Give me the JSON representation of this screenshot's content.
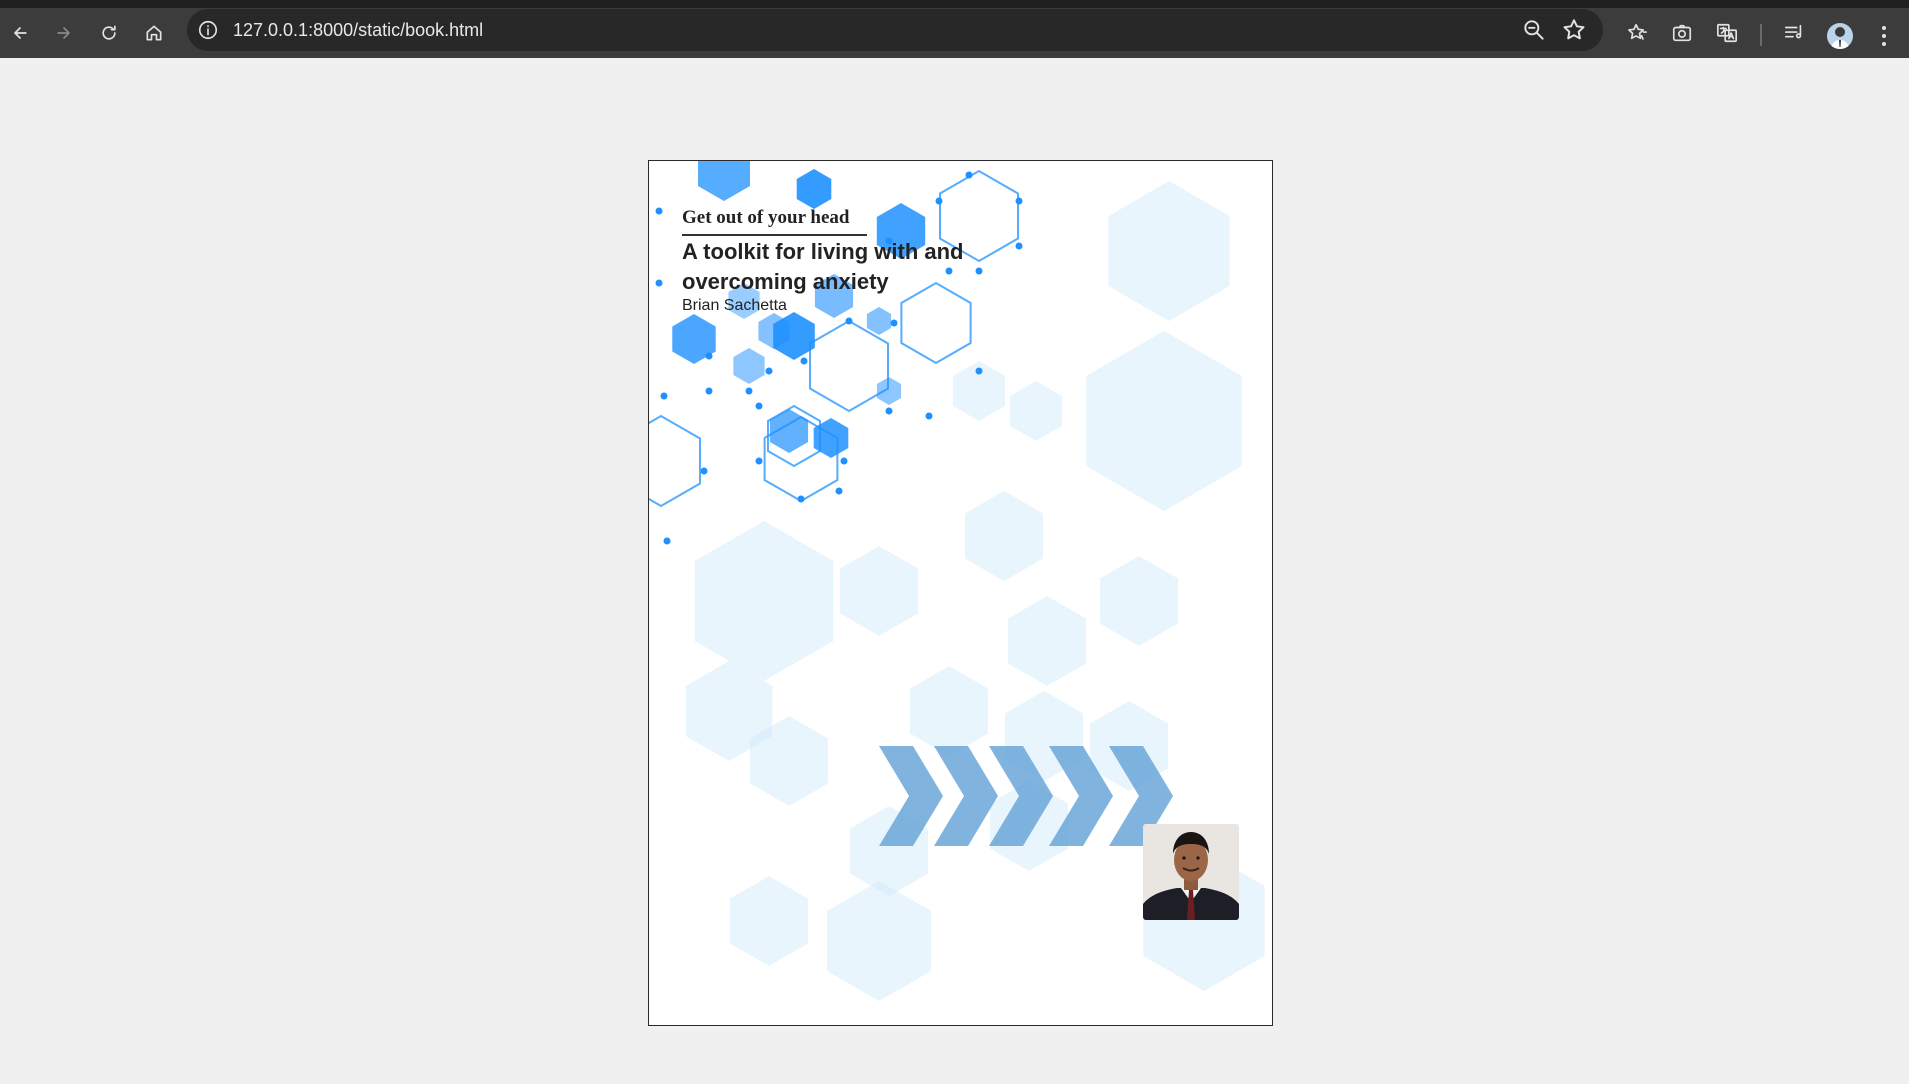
{
  "browser": {
    "url": "127.0.0.1:8000/static/book.html",
    "colors": {
      "frame": "#3c3c3c",
      "omnibox": "#282828",
      "icon": "#e3e3e3"
    },
    "icons": [
      "back-arrow-icon",
      "forward-arrow-icon",
      "reload-icon",
      "home-icon",
      "site-info-icon",
      "zoom-icon",
      "bookmark-star-icon",
      "bookmarks-icon",
      "screenshot-icon",
      "translate-icon",
      "reading-list-icon",
      "profile-avatar",
      "kebab-menu-icon"
    ]
  },
  "book": {
    "series_title": "Get out of your head",
    "title": "A toolkit for living with and overcoming anxiety",
    "author": "Brian Sachetta",
    "colors": {
      "hex_dark": "#1e90ff",
      "hex_light": "#cfe8fa",
      "chevrons": "#6aa6d8"
    }
  }
}
